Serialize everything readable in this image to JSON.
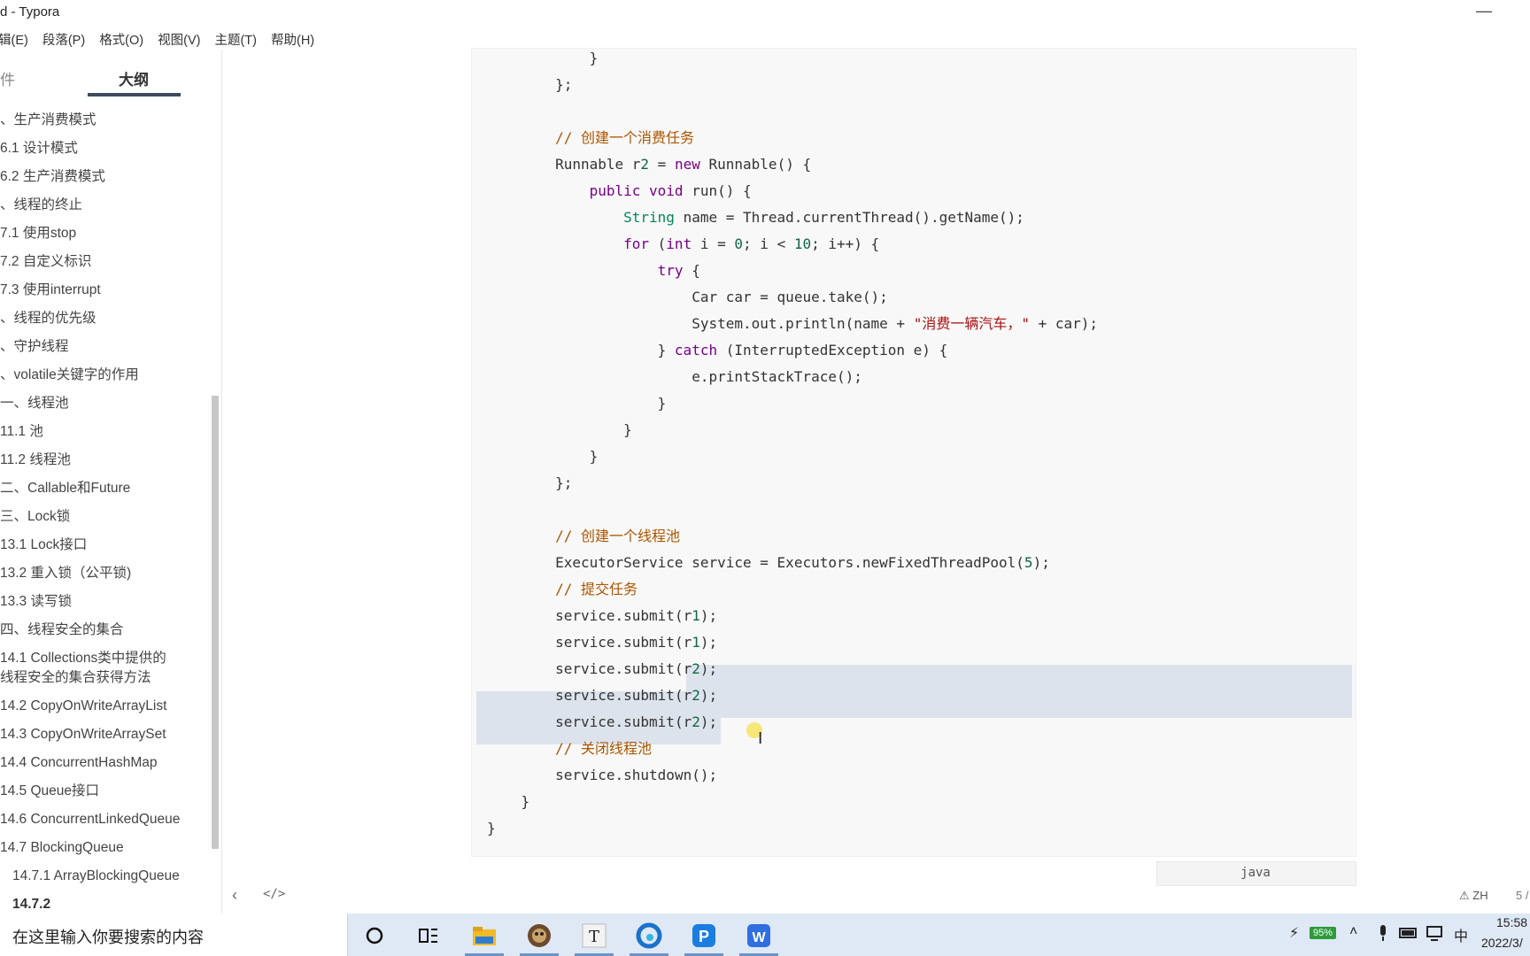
{
  "window": {
    "title": "d - Typora",
    "minimize_glyph": "—"
  },
  "menubar": [
    "辑(E)",
    "段落(P)",
    "格式(O)",
    "视图(V)",
    "主题(T)",
    "帮助(H)"
  ],
  "sidebar": {
    "tabs": {
      "files": "件",
      "outline": "大纲"
    },
    "outline": [
      "、生产消费模式",
      "6.1 设计模式",
      "6.2 生产消费模式",
      "、线程的终止",
      "7.1 使用stop",
      "7.2 自定义标识",
      "7.3 使用interrupt",
      "、线程的优先级",
      "、守护线程",
      "、volatile关键字的作用",
      "一、线程池",
      "11.1 池",
      "11.2 线程池",
      "二、Callable和Future",
      "三、Lock锁",
      "13.1 Lock接口",
      "13.2 重入锁（公平锁)",
      "13.3 读写锁",
      "四、线程安全的集合",
      "14.1 Collections类中提供的",
      "线程安全的集合获得方法",
      "14.2 CopyOnWriteArrayList",
      "14.3 CopyOnWriteArraySet",
      "14.4 ConcurrentHashMap",
      "14.5 Queue接口",
      "14.6 ConcurrentLinkedQueue",
      "14.7 BlockingQueue",
      "14.7.1 ArrayBlockingQueue",
      "14.7.2"
    ],
    "footer": {
      "back_glyph": "‹",
      "source_glyph": "</>"
    }
  },
  "code": {
    "language": "java",
    "lines": [
      "            }",
      "        };",
      "",
      "        // 创建一个消费任务",
      "        Runnable r2 = new Runnable() {",
      "            public void run() {",
      "                String name = Thread.currentThread().getName();",
      "                for (int i = 0; i < 10; i++) {",
      "                    try {",
      "                        Car car = queue.take();",
      "                        System.out.println(name + \"消费一辆汽车，\" + car);",
      "                    } catch (InterruptedException e) {",
      "                        e.printStackTrace();",
      "                    }",
      "                }",
      "            }",
      "        };",
      "",
      "        // 创建一个线程池",
      "        ExecutorService service = Executors.newFixedThreadPool(5);",
      "        // 提交任务",
      "        service.submit(r1);",
      "        service.submit(r1);",
      "        service.submit(r2);",
      "        service.submit(r2);",
      "        service.submit(r2);",
      "        // 关闭线程池",
      "        service.shutdown();",
      "    }",
      "}"
    ]
  },
  "status": {
    "warning": "⚠ ZH",
    "page": "5 /"
  },
  "taskbar": {
    "search_placeholder": "在这里输入你要搜索的内容",
    "apps": [
      "cortana-icon",
      "task-view-icon",
      "file-explorer-icon",
      "game-app-icon",
      "typora-icon",
      "edge-icon",
      "pdf-app-icon",
      "wps-icon"
    ],
    "battery": "95%",
    "ime": "中",
    "time": "15:58",
    "date": "2022/3/"
  },
  "colors": {
    "accent": "#3f4a5a",
    "selection": "#dde3ec",
    "taskbar": "#dfe8f5"
  }
}
